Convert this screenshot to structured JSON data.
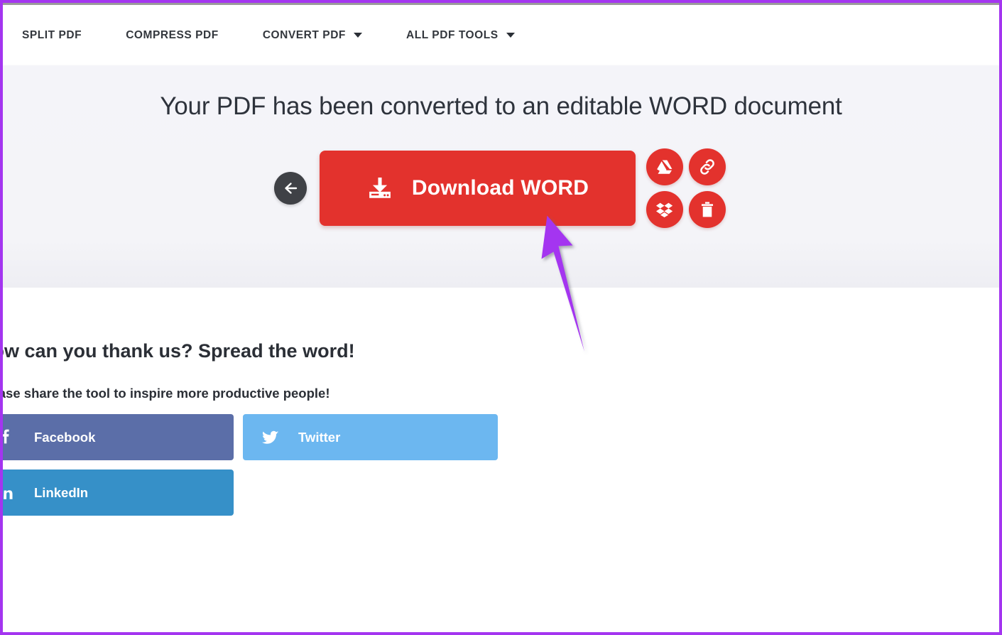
{
  "colors": {
    "annotation_purple": "#a435f0",
    "primary_red": "#e3322d",
    "hero_background": "#f4f4f8",
    "back_button": "#3f4146",
    "facebook": "#5b6ea8",
    "twitter": "#6cb7f0",
    "linkedin": "#3690c8"
  },
  "header": {
    "nav_items": [
      {
        "label": "SPLIT PDF",
        "has_caret": false,
        "icon": ""
      },
      {
        "label": "COMPRESS PDF",
        "has_caret": false,
        "icon": ""
      },
      {
        "label": "CONVERT PDF",
        "has_caret": true,
        "icon": "chevron-down-icon"
      },
      {
        "label": "ALL PDF TOOLS",
        "has_caret": true,
        "icon": "chevron-down-icon"
      }
    ]
  },
  "hero": {
    "title": "Your PDF has been converted to an editable WORD document",
    "back_button": {
      "icon": "arrow-left-icon",
      "label": ""
    },
    "download_button": {
      "label": "Download WORD",
      "icon": "download-icon"
    },
    "side_actions": [
      {
        "name": "save-to-google-drive",
        "icon": "google-drive-icon"
      },
      {
        "name": "copy-link",
        "icon": "link-icon"
      },
      {
        "name": "save-to-dropbox",
        "icon": "dropbox-icon"
      },
      {
        "name": "delete-file",
        "icon": "trash-icon"
      }
    ]
  },
  "share": {
    "title": "How can you thank us? Spread the word!",
    "subtitle": "Please share the tool to inspire more productive people!",
    "buttons": [
      {
        "label": "Facebook",
        "icon": "facebook-icon"
      },
      {
        "label": "Twitter",
        "icon": "twitter-icon"
      },
      {
        "label": "LinkedIn",
        "icon": "linkedin-icon"
      }
    ]
  },
  "annotation": {
    "type": "arrow",
    "color": "#a435f0",
    "points_to": "Download WORD"
  }
}
